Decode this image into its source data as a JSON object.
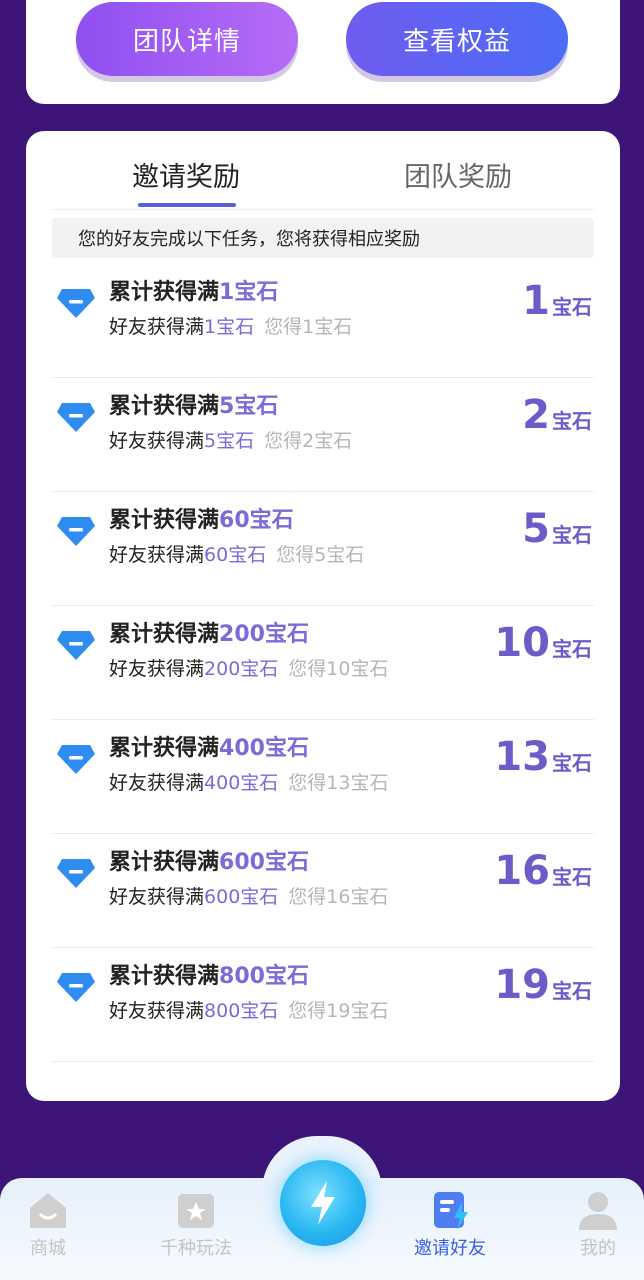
{
  "top_buttons": {
    "team_details": "团队详情",
    "view_rights": "查看权益"
  },
  "tabs": {
    "invite_reward": "邀请奖励",
    "team_reward": "团队奖励"
  },
  "notice": "您的好友完成以下任务，您将获得相应奖励",
  "rewards": [
    {
      "title_prefix": "累计获得满",
      "title_accent": "1宝石",
      "sub_prefix": "好友获得满",
      "sub_accent": "1宝石",
      "sub_muted": "您得1宝石",
      "amount": "1",
      "unit": "宝石"
    },
    {
      "title_prefix": "累计获得满",
      "title_accent": "5宝石",
      "sub_prefix": "好友获得满",
      "sub_accent": "5宝石",
      "sub_muted": "您得2宝石",
      "amount": "2",
      "unit": "宝石"
    },
    {
      "title_prefix": "累计获得满",
      "title_accent": "60宝石",
      "sub_prefix": "好友获得满",
      "sub_accent": "60宝石",
      "sub_muted": "您得5宝石",
      "amount": "5",
      "unit": "宝石"
    },
    {
      "title_prefix": "累计获得满",
      "title_accent": "200宝石",
      "sub_prefix": "好友获得满",
      "sub_accent": "200宝石",
      "sub_muted": "您得10宝石",
      "amount": "10",
      "unit": "宝石"
    },
    {
      "title_prefix": "累计获得满",
      "title_accent": "400宝石",
      "sub_prefix": "好友获得满",
      "sub_accent": "400宝石",
      "sub_muted": "您得13宝石",
      "amount": "13",
      "unit": "宝石"
    },
    {
      "title_prefix": "累计获得满",
      "title_accent": "600宝石",
      "sub_prefix": "好友获得满",
      "sub_accent": "600宝石",
      "sub_muted": "您得16宝石",
      "amount": "16",
      "unit": "宝石"
    },
    {
      "title_prefix": "累计获得满",
      "title_accent": "800宝石",
      "sub_prefix": "好友获得满",
      "sub_accent": "800宝石",
      "sub_muted": "您得19宝石",
      "amount": "19",
      "unit": "宝石"
    }
  ],
  "bottom_nav": {
    "shop": "商城",
    "play": "千种玩法",
    "invite": "邀请好友",
    "me": "我的"
  },
  "colors": {
    "background": "#3d1478",
    "accent": "#7a6bd6",
    "reward_amount": "#6b5cc9",
    "active_nav": "#3a5ee0",
    "gem": "#2f8cf0"
  },
  "icons": {
    "row_icon": "gem-icon",
    "center_button": "lightning-icon"
  }
}
